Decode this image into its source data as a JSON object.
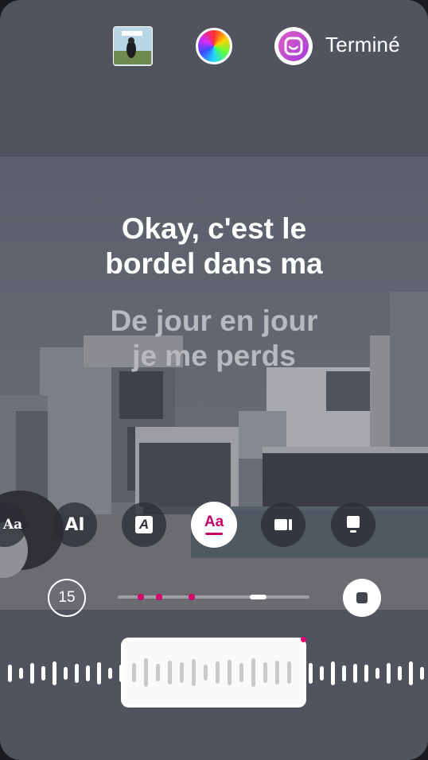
{
  "header": {
    "done_label": "Terminé",
    "album_art_icon": "album-art-thumbnail",
    "color_picker_icon": "color-wheel-icon",
    "sticker_icon": "sticker-face-icon"
  },
  "lyrics": {
    "current": [
      "Okay, c'est le",
      "bordel dans ma"
    ],
    "next": [
      "De jour en jour",
      "je me perds"
    ]
  },
  "lyric_styles": [
    {
      "name": "style-typewriter",
      "label": "Aa"
    },
    {
      "name": "style-bold-block",
      "label": "AI"
    },
    {
      "name": "style-italic-box",
      "label": "A"
    },
    {
      "name": "style-underline",
      "label": "Aa",
      "selected": true
    },
    {
      "name": "style-video-card",
      "label": ""
    },
    {
      "name": "style-card",
      "label": ""
    }
  ],
  "player": {
    "duration_seconds": "15",
    "progress_markers": [
      0.12,
      0.215,
      0.385
    ],
    "thumb_position": 0.73
  },
  "colors": {
    "accent": "#d8006a",
    "background": "#51545f"
  }
}
